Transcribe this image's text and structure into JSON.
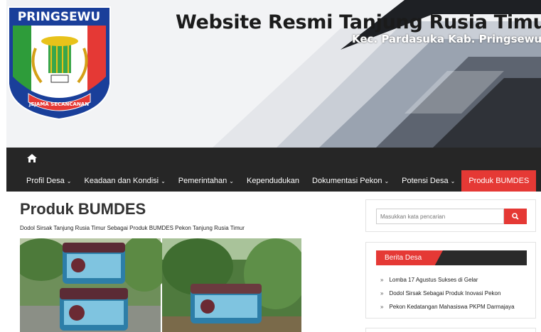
{
  "header": {
    "logo_text": "PRINGSEWU",
    "logo_motto": "JEJAMA SECANCANAN",
    "title": "Website Resmi Tanjung Rusia Timur",
    "subtitle": "Kec. Pardasuka Kab. Pringsewu"
  },
  "nav": {
    "home_icon": "home-icon",
    "items": [
      {
        "label": "Profil Desa",
        "chevron": "⌄"
      },
      {
        "label": "Keadaan dan Kondisi",
        "chevron": "⌄"
      },
      {
        "label": "Pemerintahan",
        "chevron": "⌄"
      },
      {
        "label": "Kependudukan",
        "chevron": ""
      },
      {
        "label": "Dokumentasi Pekon",
        "chevron": "⌄"
      },
      {
        "label": "Potensi Desa",
        "chevron": "⌄"
      },
      {
        "label": "Produk BUMDES",
        "chevron": ""
      }
    ],
    "active_color": "#e53935"
  },
  "main": {
    "title": "Produk BUMDES",
    "caption": "Dodol Sirsak Tanjung Rusia Timur Sebagai Produk BUMDES Pekon Tanjung Rusia Timur"
  },
  "sidebar": {
    "search": {
      "placeholder": "Masukkan kata pencarian",
      "button_icon": "search-icon"
    },
    "berita": {
      "heading": "Berita Desa",
      "bullet": "»",
      "items": [
        "Lomba 17 Agustus Sukses di Gelar",
        "Dodol Sirsak Sebagai Produk Inovasi Pekon",
        "Pekon Kedatangan Mahasiswa PKPM Darmajaya"
      ]
    }
  },
  "colors": {
    "accent": "#e53935",
    "nav_bg": "#262626"
  }
}
